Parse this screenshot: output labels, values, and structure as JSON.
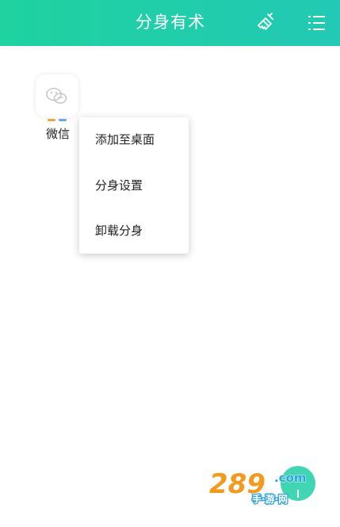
{
  "header": {
    "title": "分身有术",
    "clean_icon": "broom-icon",
    "menu_icon": "list-menu-icon"
  },
  "apps": [
    {
      "label": "微信",
      "icon": "wechat-icon",
      "indicator_colors": [
        "#f2a23a",
        "#6fa3e8"
      ]
    }
  ],
  "context_menu": {
    "items": [
      {
        "label": "添加至桌面"
      },
      {
        "label": "分身设置"
      },
      {
        "label": "卸载分身"
      }
    ]
  },
  "watermark": {
    "number": "289",
    "suffix": ".com",
    "tagline": "手·游·网"
  },
  "colors": {
    "header_start": "#1fd2a0",
    "header_end": "#22c9b4",
    "accent": "#1fcfa8",
    "watermark_orange": "#f39a1e"
  }
}
